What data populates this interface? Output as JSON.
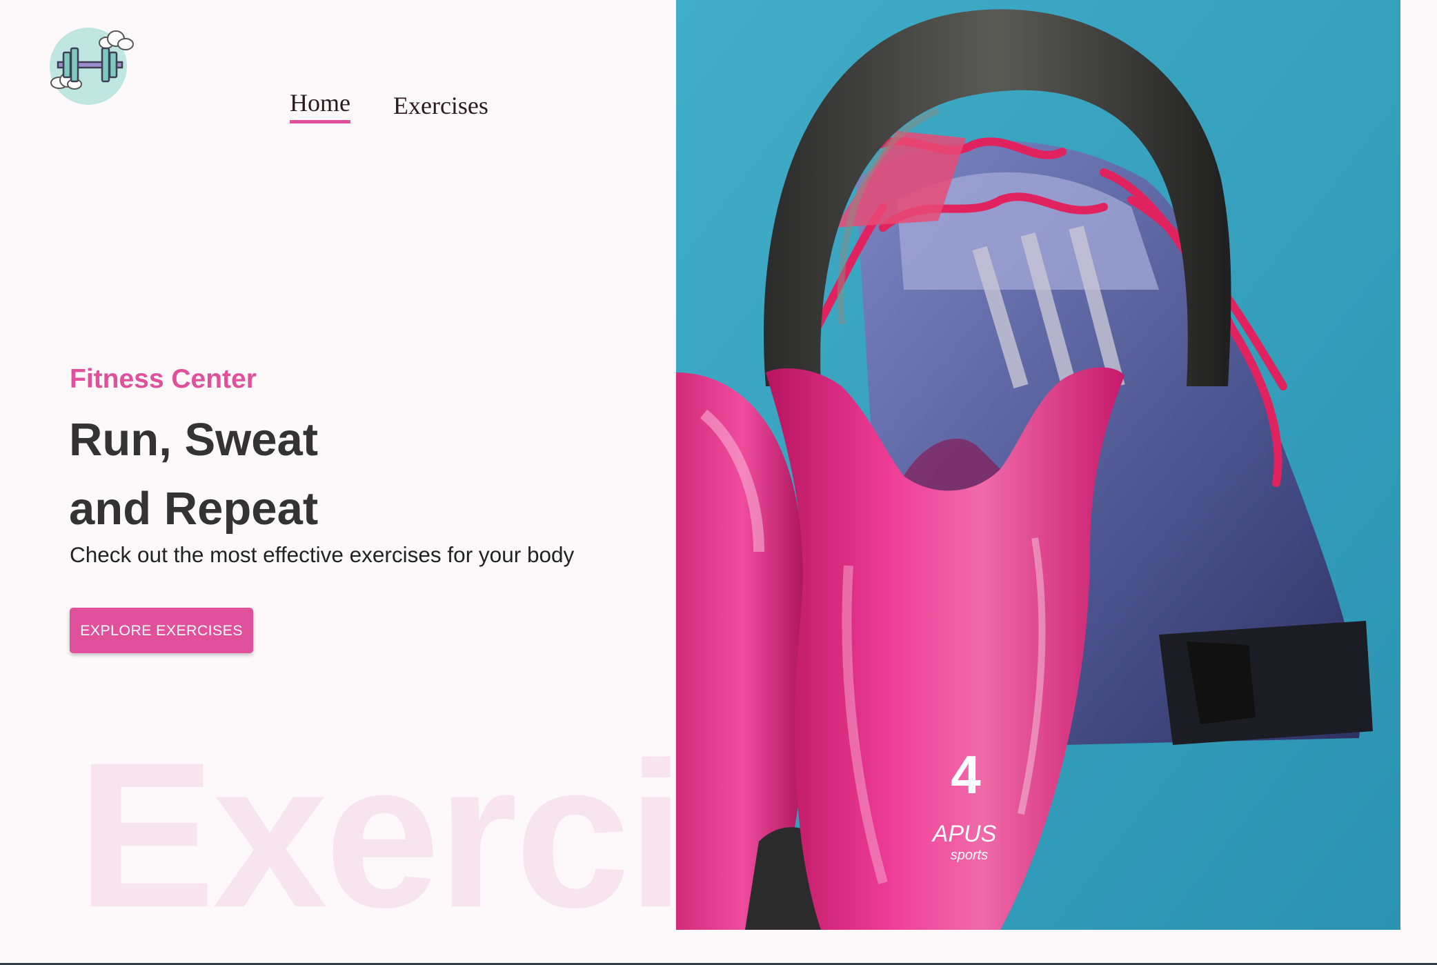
{
  "brand": {
    "logo_icon": "dumbbell-clouds-logo",
    "accent_color": "#e0509b"
  },
  "nav": {
    "items": [
      {
        "label": "Home",
        "active": true
      },
      {
        "label": "Exercises",
        "active": false
      }
    ]
  },
  "hero": {
    "kicker": "Fitness Center",
    "headline_line1": "Run, Sweat",
    "headline_line2": "and Repeat",
    "subtitle": "Check out the most effective exercises for your body",
    "cta_label": "EXPLORE EXERCISES",
    "watermark": "Exercise",
    "image": {
      "kettlebell_number": "4",
      "kettlebell_brand": "APUS",
      "kettlebell_brand_sub": "sports"
    }
  }
}
